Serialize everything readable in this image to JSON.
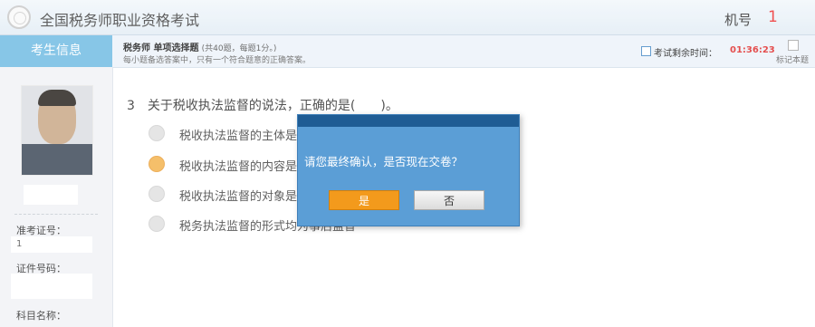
{
  "header": {
    "title": "全国税务师职业资格考试",
    "machine_label": "机号",
    "machine_number": "1"
  },
  "sidebar": {
    "title": "考生信息",
    "fields": [
      {
        "label": "准考证号：",
        "value": "1"
      },
      {
        "label": "证件号码：",
        "value": ""
      },
      {
        "label": "科目名称：",
        "value": ""
      }
    ]
  },
  "question_bar": {
    "type_title": "税务师 单项选择题",
    "type_meta": "(共40题，每题1分。)",
    "instruction": "每小题备选答案中，只有一个符合题意的正确答案。",
    "timer_label": "考试剩余时间：",
    "timer_value": "01:36:23",
    "mark_label": "标记本题"
  },
  "question": {
    "number": "3",
    "text": "关于税收执法监督的说法，正确的是(　　)。",
    "options": [
      {
        "text": "税收执法监督的主体是司",
        "selected": false
      },
      {
        "text": "税收执法监督的内容是税",
        "selected": true
      },
      {
        "text": "税收执法监督的对象是税",
        "selected": false
      },
      {
        "text": "税务执法监督的形式均为事后监督",
        "selected": false
      }
    ]
  },
  "dialog": {
    "message": "请您最终确认，是否现在交卷？",
    "yes_label": "是",
    "no_label": "否"
  },
  "colors": {
    "accent": "#72bde3",
    "dialog": "#5b9ed6",
    "yes_button": "#f39a1c",
    "timer": "#e03030"
  }
}
